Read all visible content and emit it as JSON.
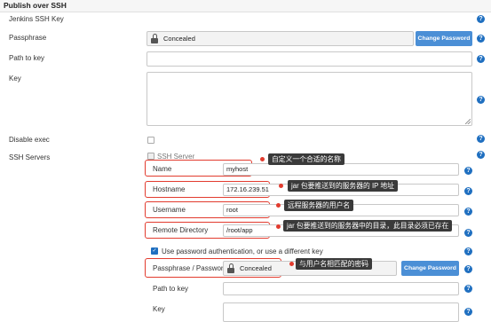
{
  "section": {
    "title": "Publish over SSH"
  },
  "labels": {
    "jenkins_ssh_key": "Jenkins SSH Key",
    "passphrase": "Passphrase",
    "path_to_key": "Path to key",
    "key": "Key",
    "disable_exec": "Disable exec",
    "ssh_servers": "SSH Servers"
  },
  "passphrase": {
    "value": "Concealed",
    "button": "Change Password"
  },
  "server": {
    "header": "SSH Server",
    "name_label": "Name",
    "name_value": "myhost",
    "hostname_label": "Hostname",
    "hostname_value": "172.16.239.51",
    "username_label": "Username",
    "username_value": "root",
    "remote_dir_label": "Remote Directory",
    "remote_dir_value": "/root/app",
    "use_password_label": "Use password authentication, or use a different key",
    "password_label": "Passphrase / Password",
    "password_value": "Concealed",
    "password_button": "Change Password",
    "path_to_key_label": "Path to key",
    "key_label": "Key"
  },
  "annotations": {
    "name": "自定义一个合适的名称",
    "hostname": "jar 包要推送到的服务器的 IP 地址",
    "username": "远程服务器的用户名",
    "remote_dir": "jar 包要推送到的服务器中的目录，此目录必须已存在",
    "password": "与用户名相匹配的密码"
  },
  "help_symbol": "?",
  "icons": {
    "help": "help-circle-icon",
    "lock": "lock-icon",
    "check": "checkmark-icon"
  },
  "colors": {
    "accent": "#1f6fc0",
    "button": "#4b8fd6",
    "highlight": "#e23b2e",
    "tooltip": "#3a3a3a"
  }
}
